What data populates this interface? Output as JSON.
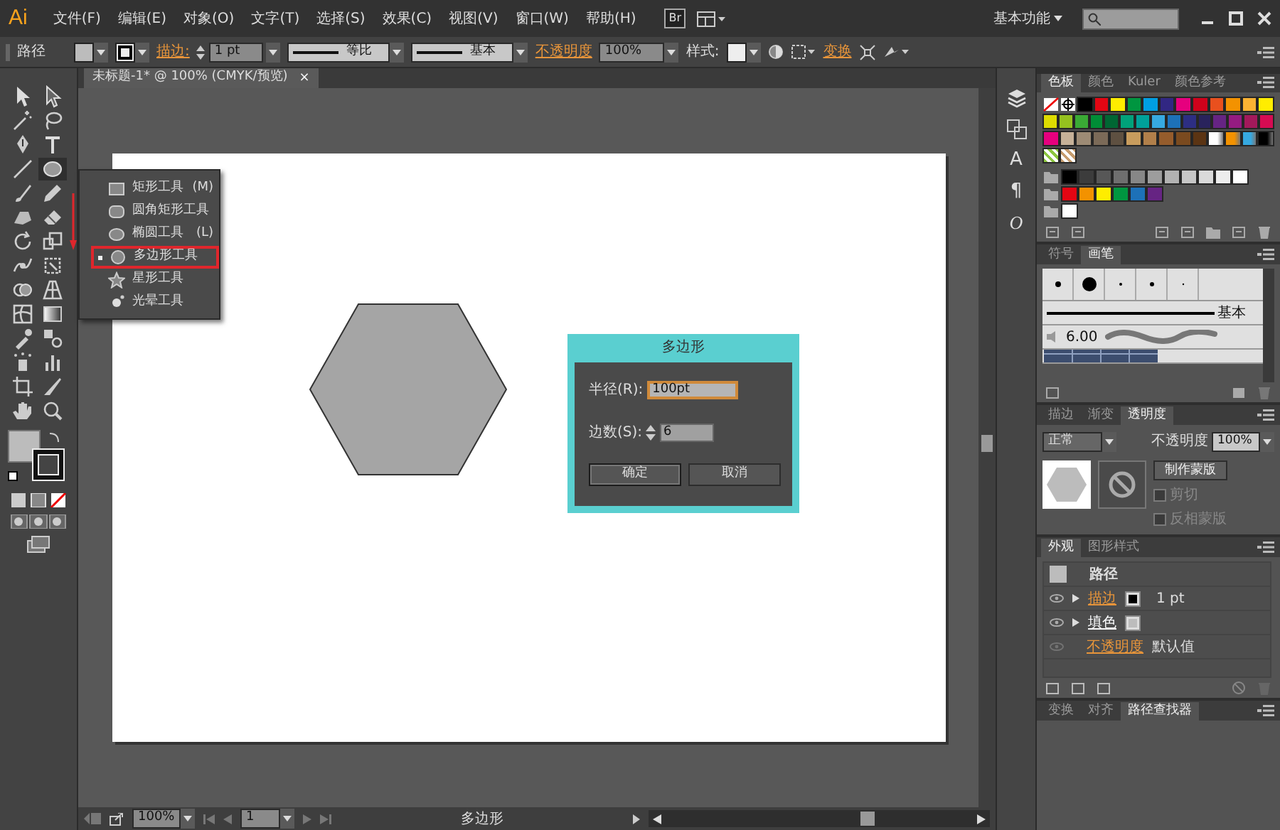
{
  "menu_bar": {
    "logo": "Ai",
    "menus": [
      "文件(F)",
      "编辑(E)",
      "对象(O)",
      "文字(T)",
      "选择(S)",
      "效果(C)",
      "视图(V)",
      "窗口(W)",
      "帮助(H)"
    ],
    "bridge": "Br",
    "workspace": "基本功能"
  },
  "control_bar": {
    "selection": "路径",
    "stroke_label": "描边:",
    "stroke_weight": "1 pt",
    "profile": "等比",
    "brush": "基本",
    "opacity_label": "不透明度",
    "opacity": "100%",
    "style_label": "样式:",
    "transform_label": "变换"
  },
  "document_tab": {
    "title": "未标题-1* @ 100% (CMYK/预览)",
    "close": "×"
  },
  "tool_flyout": {
    "items": [
      {
        "label": "矩形工具",
        "shortcut": "(M)",
        "selected": false
      },
      {
        "label": "圆角矩形工具",
        "selected": false
      },
      {
        "label": "椭圆工具",
        "shortcut": "(L)",
        "selected": false
      },
      {
        "label": "多边形工具",
        "selected": true
      },
      {
        "label": "星形工具",
        "selected": false
      },
      {
        "label": "光晕工具",
        "selected": false
      }
    ]
  },
  "polygon_dialog": {
    "title": "多边形",
    "fields": [
      {
        "label": "半径(R):",
        "value": "100pt",
        "focused": true,
        "kind": "text"
      },
      {
        "label": "边数(S):",
        "value": "6",
        "focused": false,
        "kind": "spinner"
      }
    ],
    "buttons": [
      {
        "label": "确定",
        "default": true
      },
      {
        "label": "取消",
        "default": false
      }
    ]
  },
  "status_bar": {
    "zoom": "100%",
    "artboard": "1",
    "tool": "多边形"
  },
  "dock_glyphs": [
    "A",
    "¶",
    "O"
  ],
  "swatches": {
    "tabs": [
      {
        "label": "色板",
        "selected": true
      },
      {
        "label": "颜色",
        "selected": false
      },
      {
        "label": "Kuler",
        "selected": false
      },
      {
        "label": "颜色参考",
        "selected": false
      }
    ],
    "rows": [
      [
        {
          "kind": "none"
        },
        {
          "kind": "registration"
        },
        {
          "kind": "color",
          "color": "#000000"
        },
        {
          "kind": "color",
          "color": "#e30613"
        },
        {
          "kind": "color",
          "color": "#ffed00"
        },
        {
          "kind": "color",
          "color": "#009640"
        },
        {
          "kind": "color",
          "color": "#009fe3"
        },
        {
          "kind": "color",
          "color": "#312783"
        },
        {
          "kind": "color",
          "color": "#e6007e"
        },
        {
          "kind": "color",
          "color": "#d0021b"
        },
        {
          "kind": "color",
          "color": "#e9501e"
        },
        {
          "kind": "color",
          "color": "#f39200"
        },
        {
          "kind": "color",
          "color": "#f9b233"
        },
        {
          "kind": "color",
          "color": "#ffed00"
        }
      ],
      [
        {
          "kind": "color",
          "color": "#dedc00"
        },
        {
          "kind": "color",
          "color": "#95c11f"
        },
        {
          "kind": "color",
          "color": "#3aaa35"
        },
        {
          "kind": "color",
          "color": "#008d36"
        },
        {
          "kind": "color",
          "color": "#006633"
        },
        {
          "kind": "color",
          "color": "#00a27a"
        },
        {
          "kind": "color",
          "color": "#00a19a"
        },
        {
          "kind": "color",
          "color": "#36a9e1"
        },
        {
          "kind": "color",
          "color": "#1d71b8"
        },
        {
          "kind": "color",
          "color": "#2d2e83"
        },
        {
          "kind": "color",
          "color": "#29235c"
        },
        {
          "kind": "color",
          "color": "#662483"
        },
        {
          "kind": "color",
          "color": "#951b81"
        },
        {
          "kind": "color",
          "color": "#a3195b"
        },
        {
          "kind": "color",
          "color": "#d60b52"
        }
      ],
      [
        {
          "kind": "color",
          "color": "#e6007e"
        },
        {
          "kind": "color",
          "color": "#c6b198"
        },
        {
          "kind": "color",
          "color": "#9d8b75"
        },
        {
          "kind": "color",
          "color": "#7b6a58"
        },
        {
          "kind": "color",
          "color": "#5e5041"
        },
        {
          "kind": "color",
          "color": "#c89c5d"
        },
        {
          "kind": "color",
          "color": "#b17f4a"
        },
        {
          "kind": "color",
          "color": "#955c2c"
        },
        {
          "kind": "color",
          "color": "#7a4a1f"
        },
        {
          "kind": "color",
          "color": "#5b3413"
        },
        {
          "kind": "gradient",
          "color": "#ffffff"
        },
        {
          "kind": "gradient",
          "color": "#f39200"
        },
        {
          "kind": "gradient",
          "color": "#36a9e1"
        },
        {
          "kind": "gradient",
          "color": "#000000"
        }
      ],
      [
        {
          "kind": "pattern",
          "color": "#8cc63f"
        },
        {
          "kind": "pattern",
          "color": "#c69c6d"
        }
      ],
      [
        {
          "kind": "folder"
        },
        {
          "kind": "color",
          "color": "#000000"
        },
        {
          "kind": "color",
          "color": "#3c3c3c"
        },
        {
          "kind": "color",
          "color": "#575757"
        },
        {
          "kind": "color",
          "color": "#6f6f6f"
        },
        {
          "kind": "color",
          "color": "#878787"
        },
        {
          "kind": "color",
          "color": "#9d9d9d"
        },
        {
          "kind": "color",
          "color": "#b2b2b2"
        },
        {
          "kind": "color",
          "color": "#c6c6c6"
        },
        {
          "kind": "color",
          "color": "#dadada"
        },
        {
          "kind": "color",
          "color": "#ededed"
        },
        {
          "kind": "color",
          "color": "#ffffff"
        }
      ],
      [
        {
          "kind": "folder"
        },
        {
          "kind": "color",
          "color": "#e30613"
        },
        {
          "kind": "color",
          "color": "#f39200"
        },
        {
          "kind": "color",
          "color": "#ffed00"
        },
        {
          "kind": "color",
          "color": "#009640"
        },
        {
          "kind": "color",
          "color": "#1d71b8"
        },
        {
          "kind": "color",
          "color": "#662483"
        }
      ],
      [
        {
          "kind": "folder"
        },
        {
          "kind": "color",
          "color": "#ffffff"
        }
      ]
    ]
  },
  "brushes": {
    "tabs": [
      {
        "label": "符号",
        "selected": false
      },
      {
        "label": "画笔",
        "selected": true
      }
    ],
    "calligraphic": "基本",
    "art_size": "6.00"
  },
  "transparency": {
    "tabs": [
      {
        "label": "描边",
        "selected": false
      },
      {
        "label": "渐变",
        "selected": false
      },
      {
        "label": "透明度",
        "selected": true
      }
    ],
    "blend_mode": "正常",
    "opacity_label": "不透明度",
    "opacity": "100%",
    "mask_button": "制作蒙版",
    "options": [
      {
        "label": "剪切",
        "checked": false,
        "disabled": true
      },
      {
        "label": "反相蒙版",
        "checked": false,
        "disabled": true
      }
    ]
  },
  "appearance": {
    "tabs": [
      {
        "label": "外观",
        "selected": true
      },
      {
        "label": "图形样式",
        "selected": false
      }
    ],
    "rows": [
      {
        "kind": "header",
        "label": "路径"
      },
      {
        "kind": "stroke",
        "label": "描边",
        "value": "1 pt"
      },
      {
        "kind": "fill",
        "label": "填色"
      },
      {
        "kind": "opacity",
        "label": "不透明度",
        "value": "默认值"
      }
    ]
  },
  "pathfinder": {
    "tabs": [
      {
        "label": "变换",
        "selected": false
      },
      {
        "label": "对齐",
        "selected": false
      },
      {
        "label": "路径查找器",
        "selected": true
      }
    ]
  }
}
